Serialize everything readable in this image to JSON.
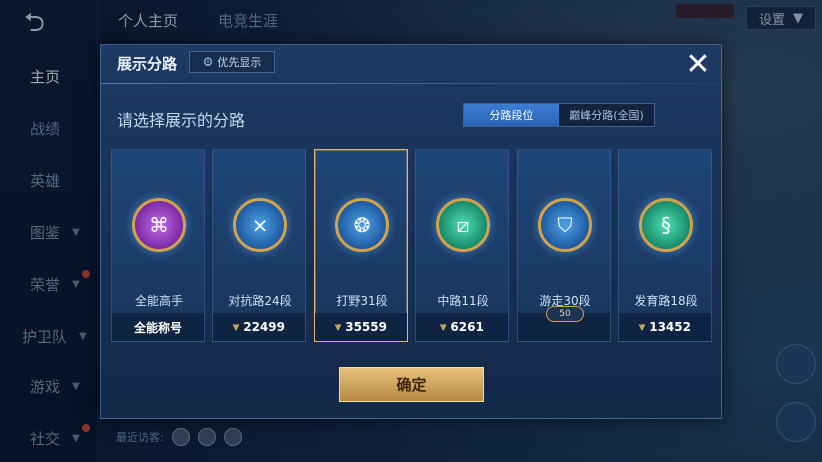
{
  "top_tabs": [
    "个人主页",
    "电竞生涯"
  ],
  "settings_label": "设置",
  "left_nav": {
    "back_icon": "back-arrow-icon",
    "items": [
      {
        "label": "主页",
        "active": true,
        "has_chevron": false
      },
      {
        "label": "战绩",
        "active": false,
        "has_chevron": false
      },
      {
        "label": "英雄",
        "active": false,
        "has_chevron": false
      },
      {
        "label": "图鉴",
        "active": false,
        "has_chevron": true
      },
      {
        "label": "荣誉",
        "active": false,
        "has_chevron": true
      },
      {
        "label": "护卫队",
        "active": false,
        "has_chevron": true
      },
      {
        "label": "游戏",
        "active": false,
        "has_chevron": true
      },
      {
        "label": "社交",
        "active": false,
        "has_chevron": true
      }
    ]
  },
  "recent_visitors_label": "最近访客:",
  "modal": {
    "title": "展示分路",
    "priority_label": "优先显示",
    "close_icon": "close-icon",
    "subtitle": "请选择展示的分路",
    "segments": [
      {
        "label": "分路段位",
        "active": true
      },
      {
        "label": "巅峰分路(全国)",
        "active": false
      }
    ],
    "cards": [
      {
        "name": "全能高手",
        "footer": "全能称号",
        "score": "",
        "emblem_color": "#9b3fc9",
        "selected": false,
        "level_badge": ""
      },
      {
        "name": "对抗路24段",
        "footer": "",
        "score": "22499",
        "emblem_color": "#2c8fe0",
        "selected": false,
        "level_badge": ""
      },
      {
        "name": "打野31段",
        "footer": "",
        "score": "35559",
        "emblem_color": "#2c8fe0",
        "selected": true,
        "level_badge": ""
      },
      {
        "name": "中路11段",
        "footer": "",
        "score": "6261",
        "emblem_color": "#25b890",
        "selected": false,
        "level_badge": ""
      },
      {
        "name": "游走30段",
        "footer": "",
        "score": "",
        "emblem_color": "#2c8fe0",
        "selected": false,
        "level_badge": "50"
      },
      {
        "name": "发育路18段",
        "footer": "",
        "score": "13452",
        "emblem_color": "#25b890",
        "selected": false,
        "level_badge": ""
      }
    ],
    "confirm_label": "确定"
  }
}
